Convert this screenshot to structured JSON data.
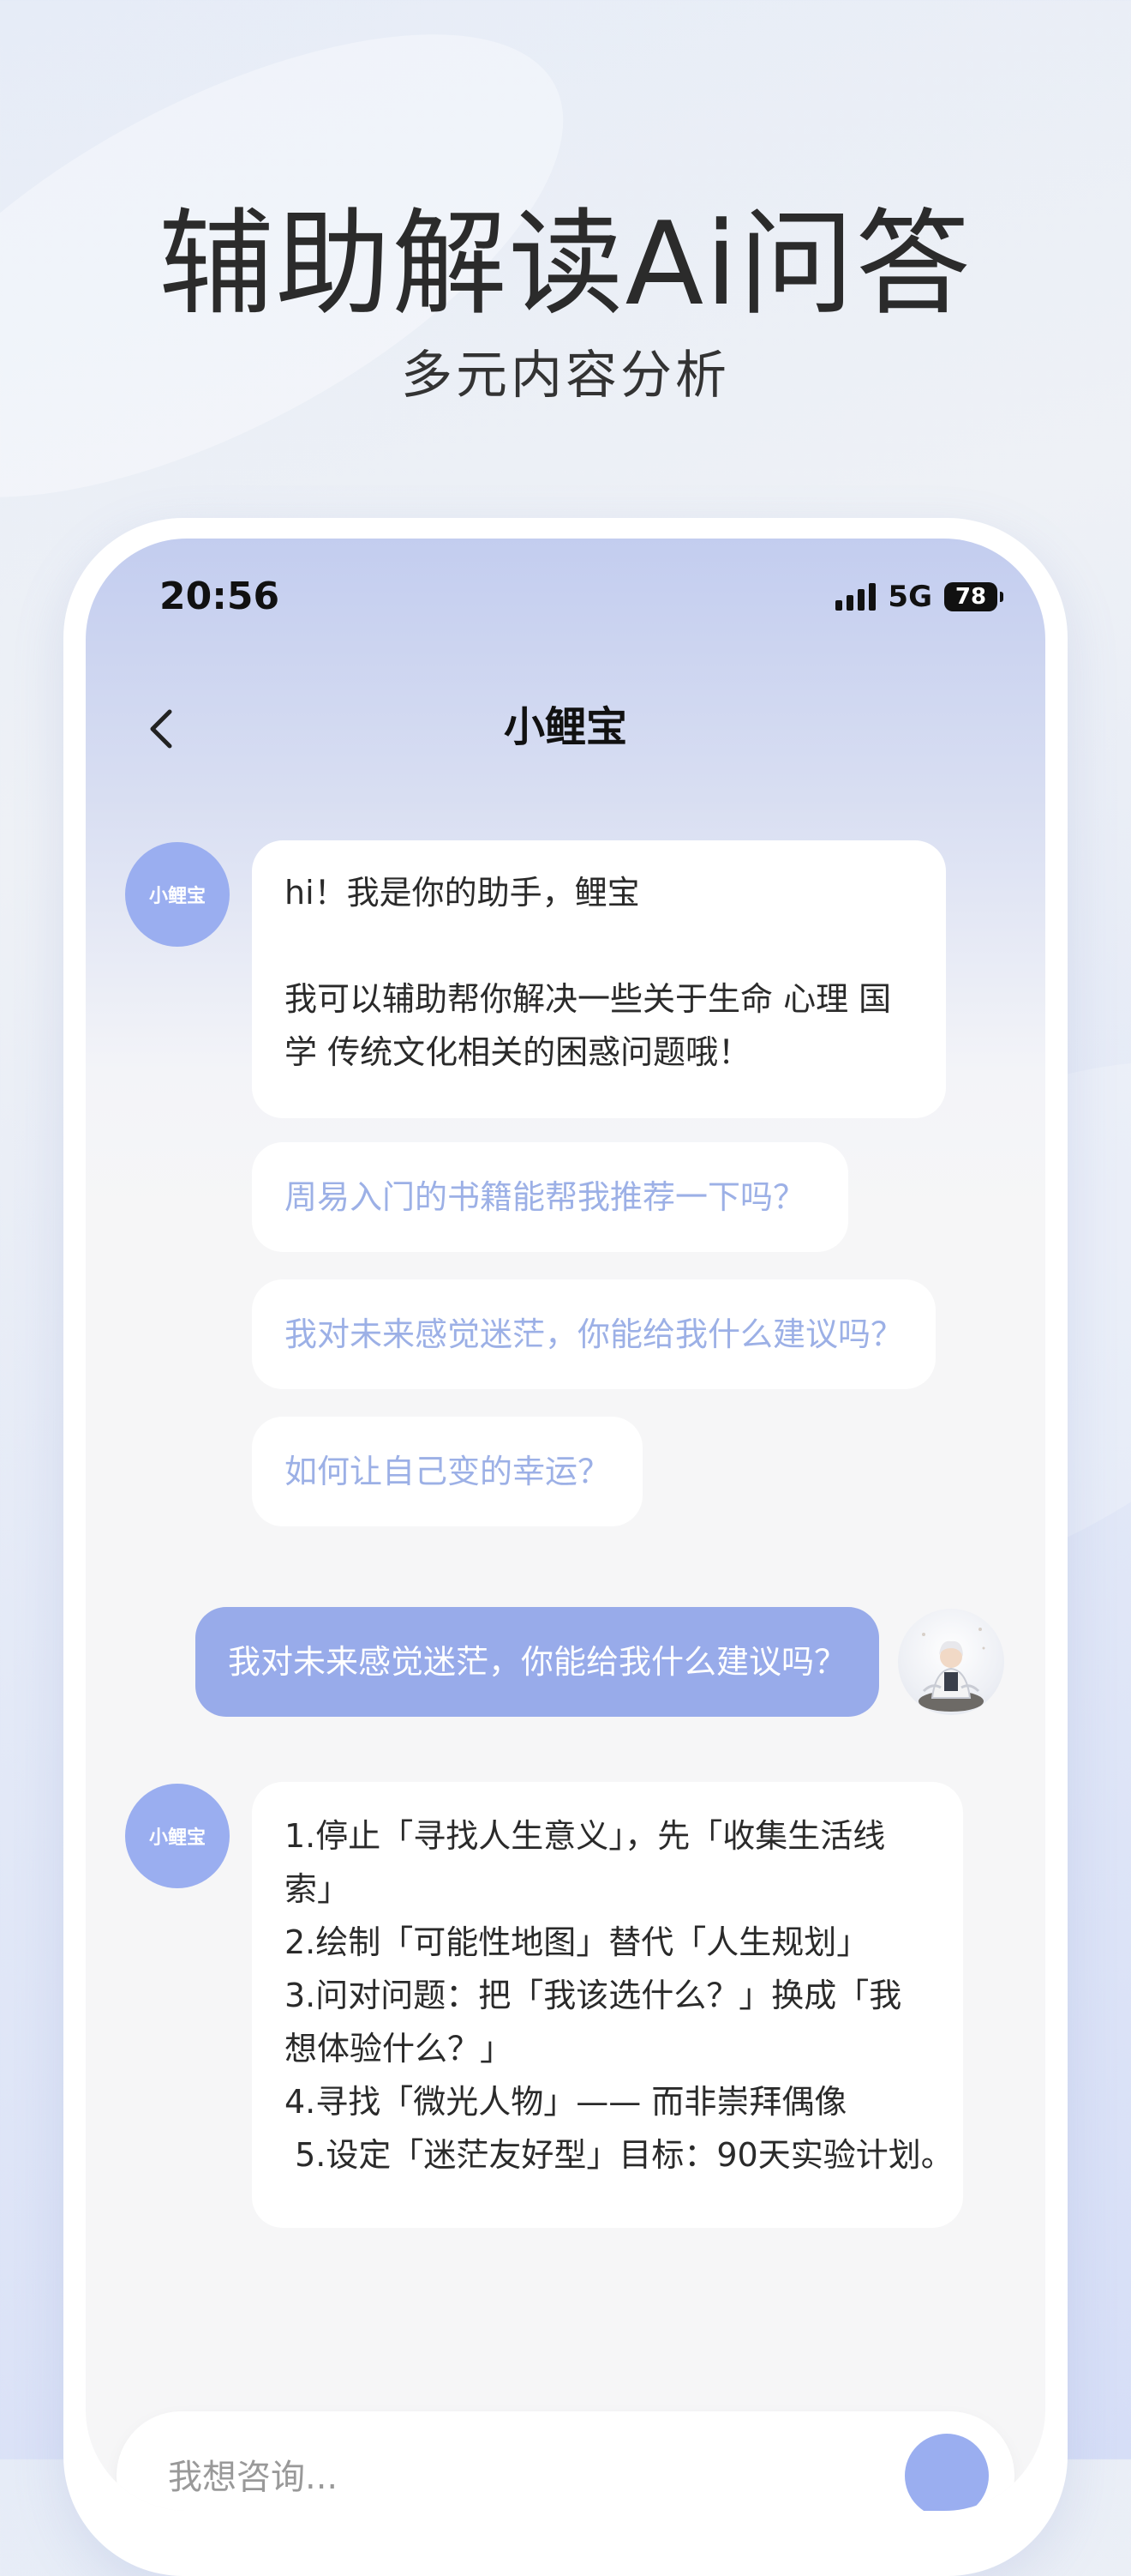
{
  "promo": {
    "headline": "辅助解读Ai问答",
    "subheadline": "多元内容分析"
  },
  "status_bar": {
    "time": "20:56",
    "network": "5G",
    "battery": "78"
  },
  "nav": {
    "title": "小鲤宝",
    "back_icon": "chevron-left-icon"
  },
  "bot": {
    "avatar_label": "小鲤宝"
  },
  "chat": {
    "greeting_line1": "hi！我是你的助手，鲤宝",
    "greeting_line2": "我可以辅助帮你解决一些关于生命 心理 国学 传统文化相关的困惑问题哦！",
    "suggestions": [
      "周易入门的书籍能帮我推荐一下吗？",
      "我对未来感觉迷茫，你能给我什么建议吗？",
      "如何让自己变的幸运？"
    ],
    "user_message": "我对未来感觉迷茫，你能给我什么建议吗？",
    "answer_lines": [
      "1.停止「寻找人生意义」，先「收集生活线索」",
      "2.绘制「可能性地图」替代「人生规划」",
      "3.问对问题：把「我该选什么？」换成「我想体验什么？」",
      "4.寻找「微光人物」—— 而非崇拜偶像",
      " 5.设定「迷茫友好型」目标：90天实验计划。"
    ]
  },
  "input": {
    "placeholder": "我想咨询..."
  },
  "colors": {
    "accent": "#98abea",
    "suggestion_text": "#9cb0e6",
    "chat_background": "#f6f6f7"
  }
}
